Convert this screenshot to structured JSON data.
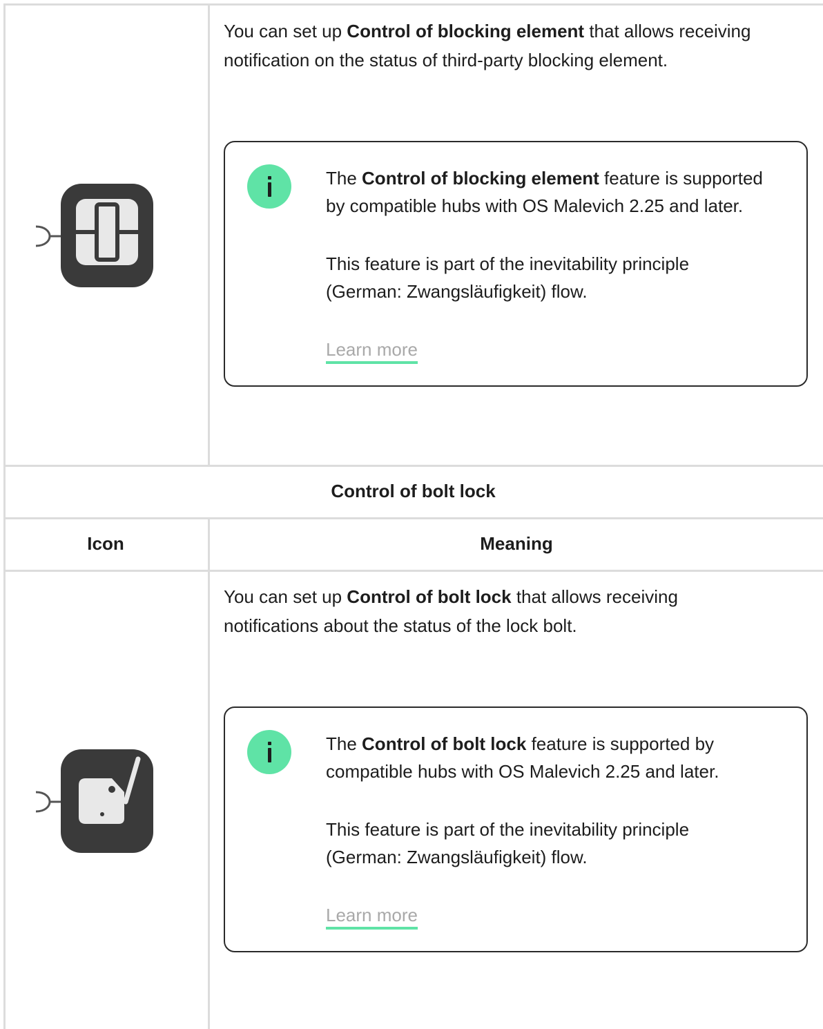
{
  "rows": [
    {
      "icon": "blocking-element-device-icon",
      "desc": {
        "prefix": "You can set up ",
        "bold": "Control of blocking element",
        "suffix_l1": " that allows receiving",
        "line2": "notification on the status of third-party blocking element."
      },
      "note": {
        "p1_pre": "The ",
        "p1_bold": "Control of blocking element",
        "p1_post": " feature is supported",
        "p1_line2": "by compatible hubs with OS Malevich 2.25 and later.",
        "p2_line1": "This feature is part of the inevitability principle",
        "p2_line2": "(German: Zwangsläufigkeit) flow.",
        "link": "Learn more"
      }
    },
    {
      "icon": "bolt-lock-device-icon",
      "desc": {
        "prefix": "You can set up ",
        "bold": "Control of bolt lock",
        "suffix_l1": " that allows receiving",
        "line2": "notifications about the status of the lock bolt."
      },
      "note": {
        "p1_pre": "The ",
        "p1_bold": "Control of bolt lock",
        "p1_post": " feature is supported by",
        "p1_line2": "compatible hubs with OS Malevich 2.25 and later.",
        "p2_line1": "This feature is part of the inevitability principle",
        "p2_line2": "(German: Zwangsläufigkeit) flow.",
        "link": "Learn more"
      }
    }
  ],
  "section_title": "Control of bolt lock",
  "headers": {
    "icon": "Icon",
    "meaning": "Meaning"
  },
  "colors": {
    "accent": "#5fe3a6",
    "border": "#dcdcdc",
    "device": "#3a3a3a"
  }
}
